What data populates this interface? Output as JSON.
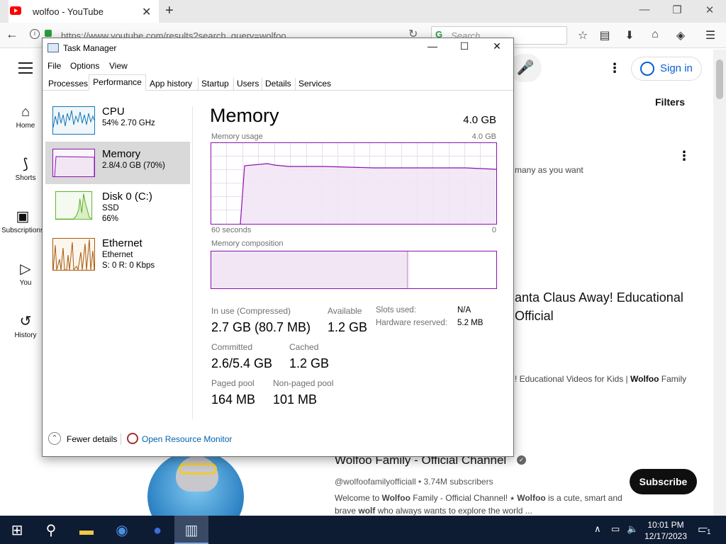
{
  "browser": {
    "tab_title": "wolfoo - YouTube",
    "url": "https://www.youtube.com/results?search_query=wolfoo",
    "search_placeholder": "Search",
    "new_tab": "+",
    "tab_close": "✕"
  },
  "youtube": {
    "nav": [
      {
        "icon": "home-icon",
        "label": "Home"
      },
      {
        "icon": "shorts-icon",
        "label": "Shorts"
      },
      {
        "icon": "subscriptions-icon",
        "label": "Subscriptions"
      },
      {
        "icon": "you-icon",
        "label": "You"
      },
      {
        "icon": "history-icon",
        "label": "History"
      }
    ],
    "sign_in": "Sign in",
    "filters": "Filters",
    "promo_fragment": "many as you want",
    "video_title_fragment": "anta Claus Away! Educational\nOfficial",
    "video_desc_fragment_pre": "! Educational Videos for Kids | ",
    "video_desc_bold1": "Wolfoo",
    "video_desc_fragment_post": " Family",
    "channel_name": "Wolfoo Family - Official Channel",
    "channel_meta": "@wolfoofamilyofficiall • 3.74M subscribers",
    "channel_desc_1a": "Welcome to ",
    "channel_desc_1b": "Wolfoo",
    "channel_desc_1c": " Family - Official Channel! ⭑ ",
    "channel_desc_1d": "Wolfoo",
    "channel_desc_1e": " is a cute, smart and",
    "channel_desc_2a": "brave ",
    "channel_desc_2b": "wolf",
    "channel_desc_2c": " who always wants to explore the world ...",
    "subscribe": "Subscribe"
  },
  "task_manager": {
    "title": "Task Manager",
    "menu": [
      "File",
      "Options",
      "View"
    ],
    "tabs": [
      "Processes",
      "Performance",
      "App history",
      "Startup",
      "Users",
      "Details",
      "Services"
    ],
    "active_tab": "Performance",
    "sidebar": [
      {
        "name": "CPU",
        "sub1": "54%  2.70 GHz",
        "sub2": "",
        "sub3": ""
      },
      {
        "name": "Memory",
        "sub1": "2.8/4.0 GB (70%)",
        "sub2": "",
        "sub3": ""
      },
      {
        "name": "Disk 0 (C:)",
        "sub1": "SSD",
        "sub2": "66%",
        "sub3": ""
      },
      {
        "name": "Ethernet",
        "sub1": "Ethernet",
        "sub2": "S: 0  R: 0 Kbps",
        "sub3": ""
      }
    ],
    "heading": "Memory",
    "total": "4.0 GB",
    "usage_label": "Memory usage",
    "usage_max": "4.0 GB",
    "time_left": "60 seconds",
    "time_right": "0",
    "composition_label": "Memory composition",
    "usage_fraction": 0.7,
    "stats": {
      "in_use_label": "In use (Compressed)",
      "in_use_value": "2.7 GB (80.7 MB)",
      "available_label": "Available",
      "available_value": "1.2 GB",
      "committed_label": "Committed",
      "committed_value": "2.6/5.4 GB",
      "cached_label": "Cached",
      "cached_value": "1.2 GB",
      "paged_label": "Paged pool",
      "paged_value": "164 MB",
      "nonpaged_label": "Non-paged pool",
      "nonpaged_value": "101 MB",
      "slots_label": "Slots used:",
      "slots_value": "N/A",
      "hw_label": "Hardware reserved:",
      "hw_value": "5.2 MB"
    },
    "fewer_details": "Fewer details",
    "open_resmon": "Open Resource Monitor",
    "accent": "#8b12ae"
  },
  "taskbar": {
    "time": "10:01 PM",
    "date": "12/17/2023",
    "notification_count": "1"
  }
}
